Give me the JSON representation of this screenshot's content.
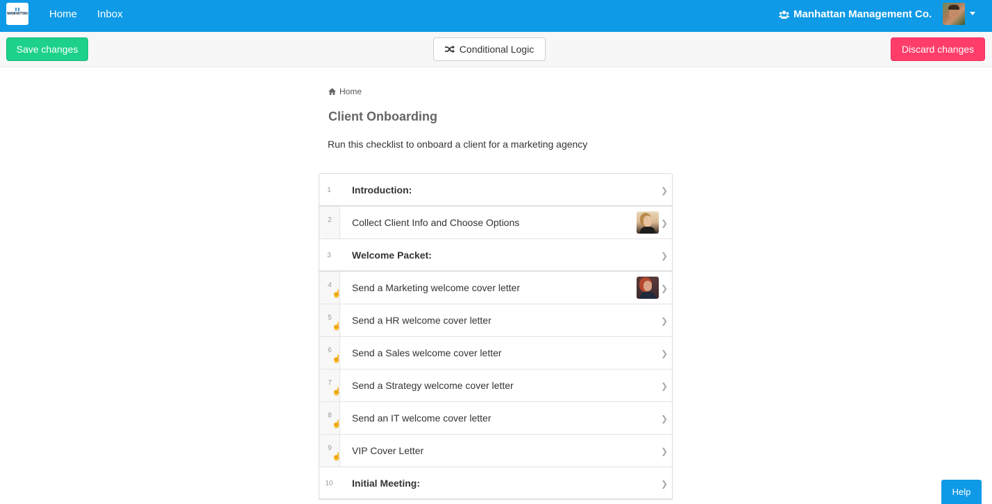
{
  "navbar": {
    "logo_text": "MANHATTAN",
    "links": [
      "Home",
      "Inbox"
    ],
    "organization": "Manhattan Management Co."
  },
  "toolbar": {
    "save_label": "Save changes",
    "logic_label": "Conditional Logic",
    "discard_label": "Discard changes"
  },
  "page": {
    "breadcrumb": "Home",
    "title": "Client Onboarding",
    "description": "Run this checklist to onboard a client for a marketing agency"
  },
  "tasks": [
    {
      "num": "1",
      "label": "Introduction:",
      "heading": true
    },
    {
      "num": "2",
      "label": "Collect Client Info and Choose Options",
      "heading": false,
      "assignee": true
    },
    {
      "num": "3",
      "label": "Welcome Packet:",
      "heading": true
    },
    {
      "num": "4",
      "label": "Send a Marketing welcome cover letter",
      "heading": false,
      "assignee": true
    },
    {
      "num": "5",
      "label": "Send a HR welcome cover letter",
      "heading": false
    },
    {
      "num": "6",
      "label": "Send a Sales welcome cover letter",
      "heading": false
    },
    {
      "num": "7",
      "label": "Send a Strategy welcome cover letter",
      "heading": false
    },
    {
      "num": "8",
      "label": "Send an IT welcome cover letter",
      "heading": false
    },
    {
      "num": "9",
      "label": "VIP Cover Letter",
      "heading": false
    },
    {
      "num": "10",
      "label": "Initial Meeting:",
      "heading": true
    }
  ],
  "help_label": "Help",
  "colors": {
    "navbar": "#0e9ae6",
    "save": "#1dd18b",
    "discard": "#ff3d6a"
  }
}
